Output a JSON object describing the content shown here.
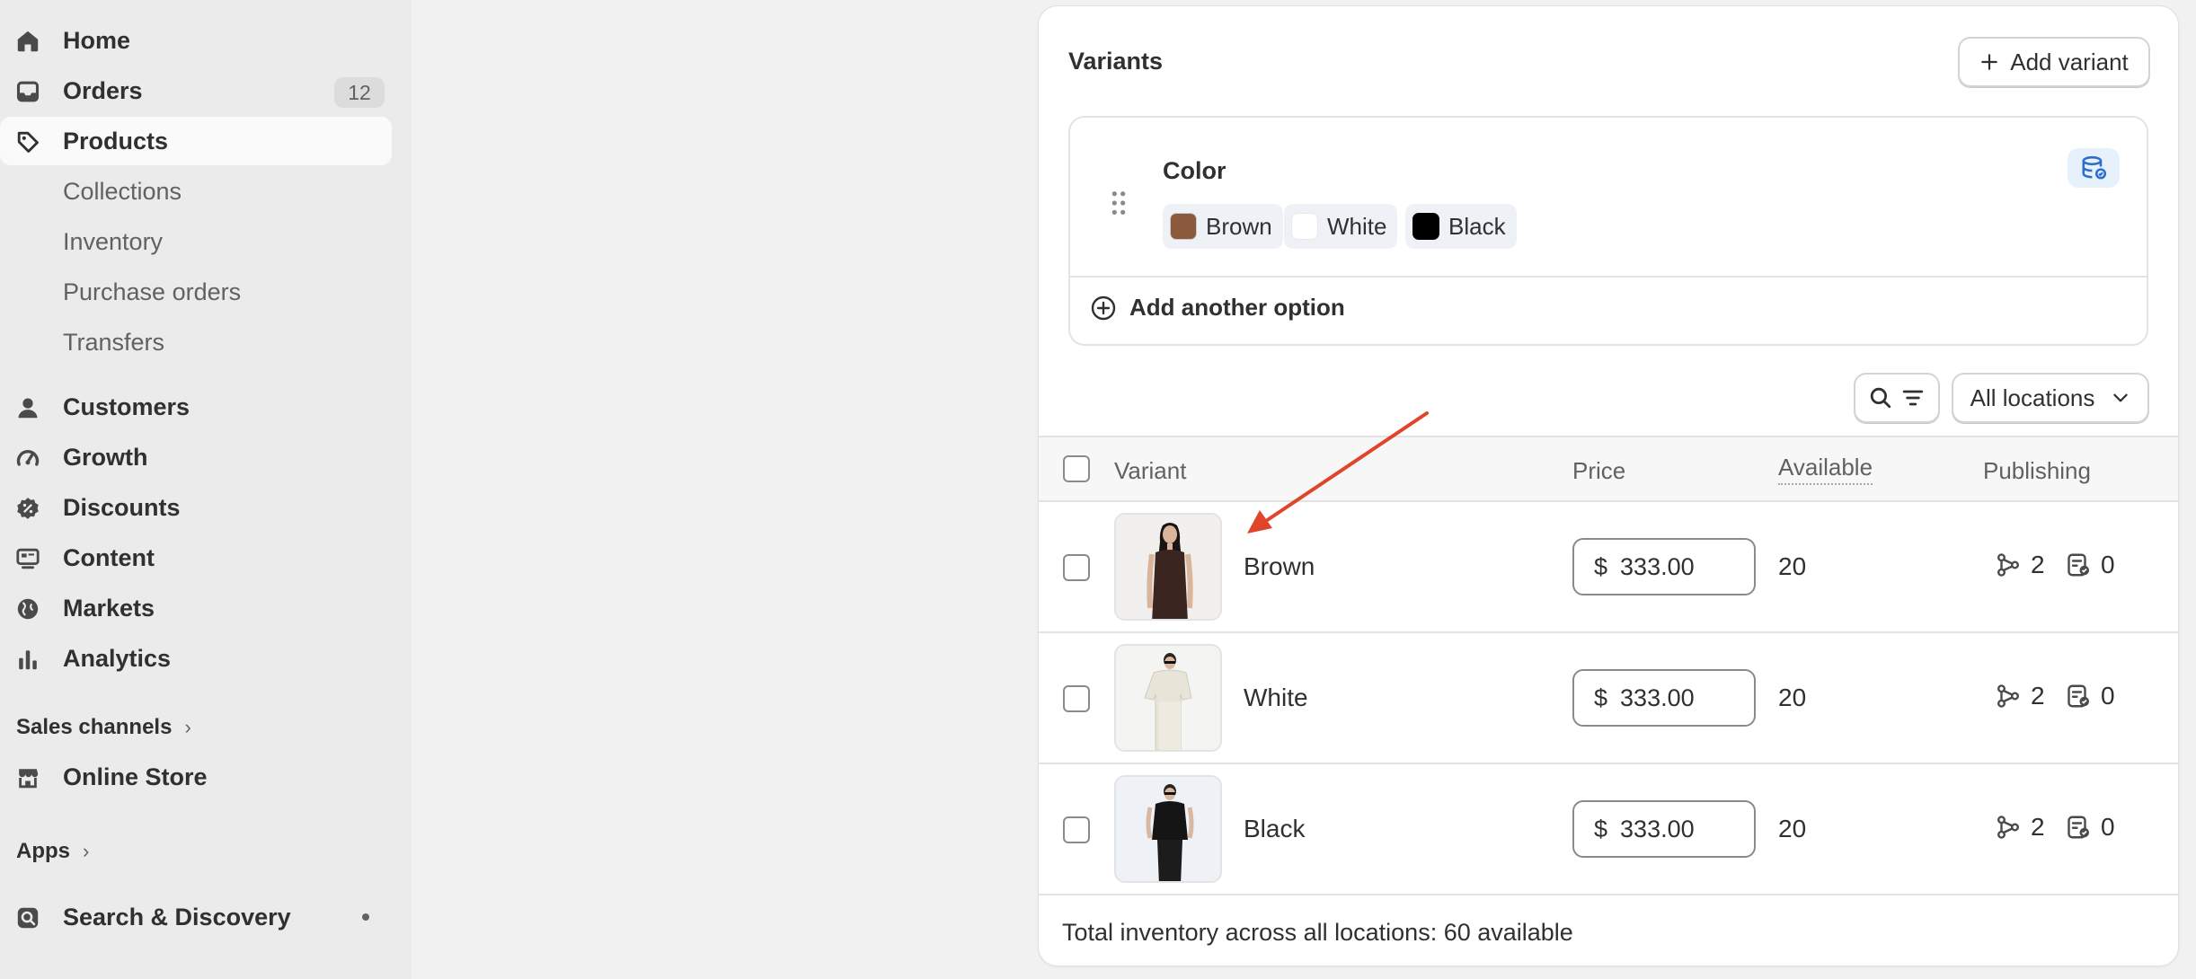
{
  "sidebar": {
    "items": [
      {
        "label": "Home",
        "icon": "home-icon"
      },
      {
        "label": "Orders",
        "icon": "inbox-icon",
        "badge": "12"
      },
      {
        "label": "Products",
        "icon": "tag-icon"
      },
      {
        "label": "Customers",
        "icon": "person-icon"
      },
      {
        "label": "Growth",
        "icon": "gauge-icon"
      },
      {
        "label": "Discounts",
        "icon": "discount-icon"
      },
      {
        "label": "Content",
        "icon": "content-icon"
      },
      {
        "label": "Markets",
        "icon": "globe-icon"
      },
      {
        "label": "Analytics",
        "icon": "bar-chart-icon"
      }
    ],
    "product_subitems": [
      "Collections",
      "Inventory",
      "Purchase orders",
      "Transfers"
    ],
    "sales_channels_label": "Sales channels",
    "online_store_label": "Online Store",
    "apps_label": "Apps",
    "search_discovery_label": "Search & Discovery"
  },
  "variants_card": {
    "title": "Variants",
    "add_variant_label": "Add variant",
    "option": {
      "name": "Color",
      "values": [
        {
          "label": "Brown",
          "color": "#8b5a3c"
        },
        {
          "label": "White",
          "color": "#ffffff"
        },
        {
          "label": "Black",
          "color": "#000000"
        }
      ]
    },
    "add_option_label": "Add another option",
    "locations_label": "All locations",
    "columns": {
      "variant": "Variant",
      "price": "Price",
      "available": "Available",
      "publishing": "Publishing"
    },
    "rows": [
      {
        "name": "Brown",
        "currency": "$",
        "price": "333.00",
        "available": "20",
        "channels": "2",
        "catalogs": "0"
      },
      {
        "name": "White",
        "currency": "$",
        "price": "333.00",
        "available": "20",
        "channels": "2",
        "catalogs": "0"
      },
      {
        "name": "Black",
        "currency": "$",
        "price": "333.00",
        "available": "20",
        "channels": "2",
        "catalogs": "0"
      }
    ],
    "footer": "Total inventory across all locations: 60 available"
  },
  "colors": {
    "annotation_arrow": "#e0452b",
    "accent_blue": "#2c6ecb"
  }
}
